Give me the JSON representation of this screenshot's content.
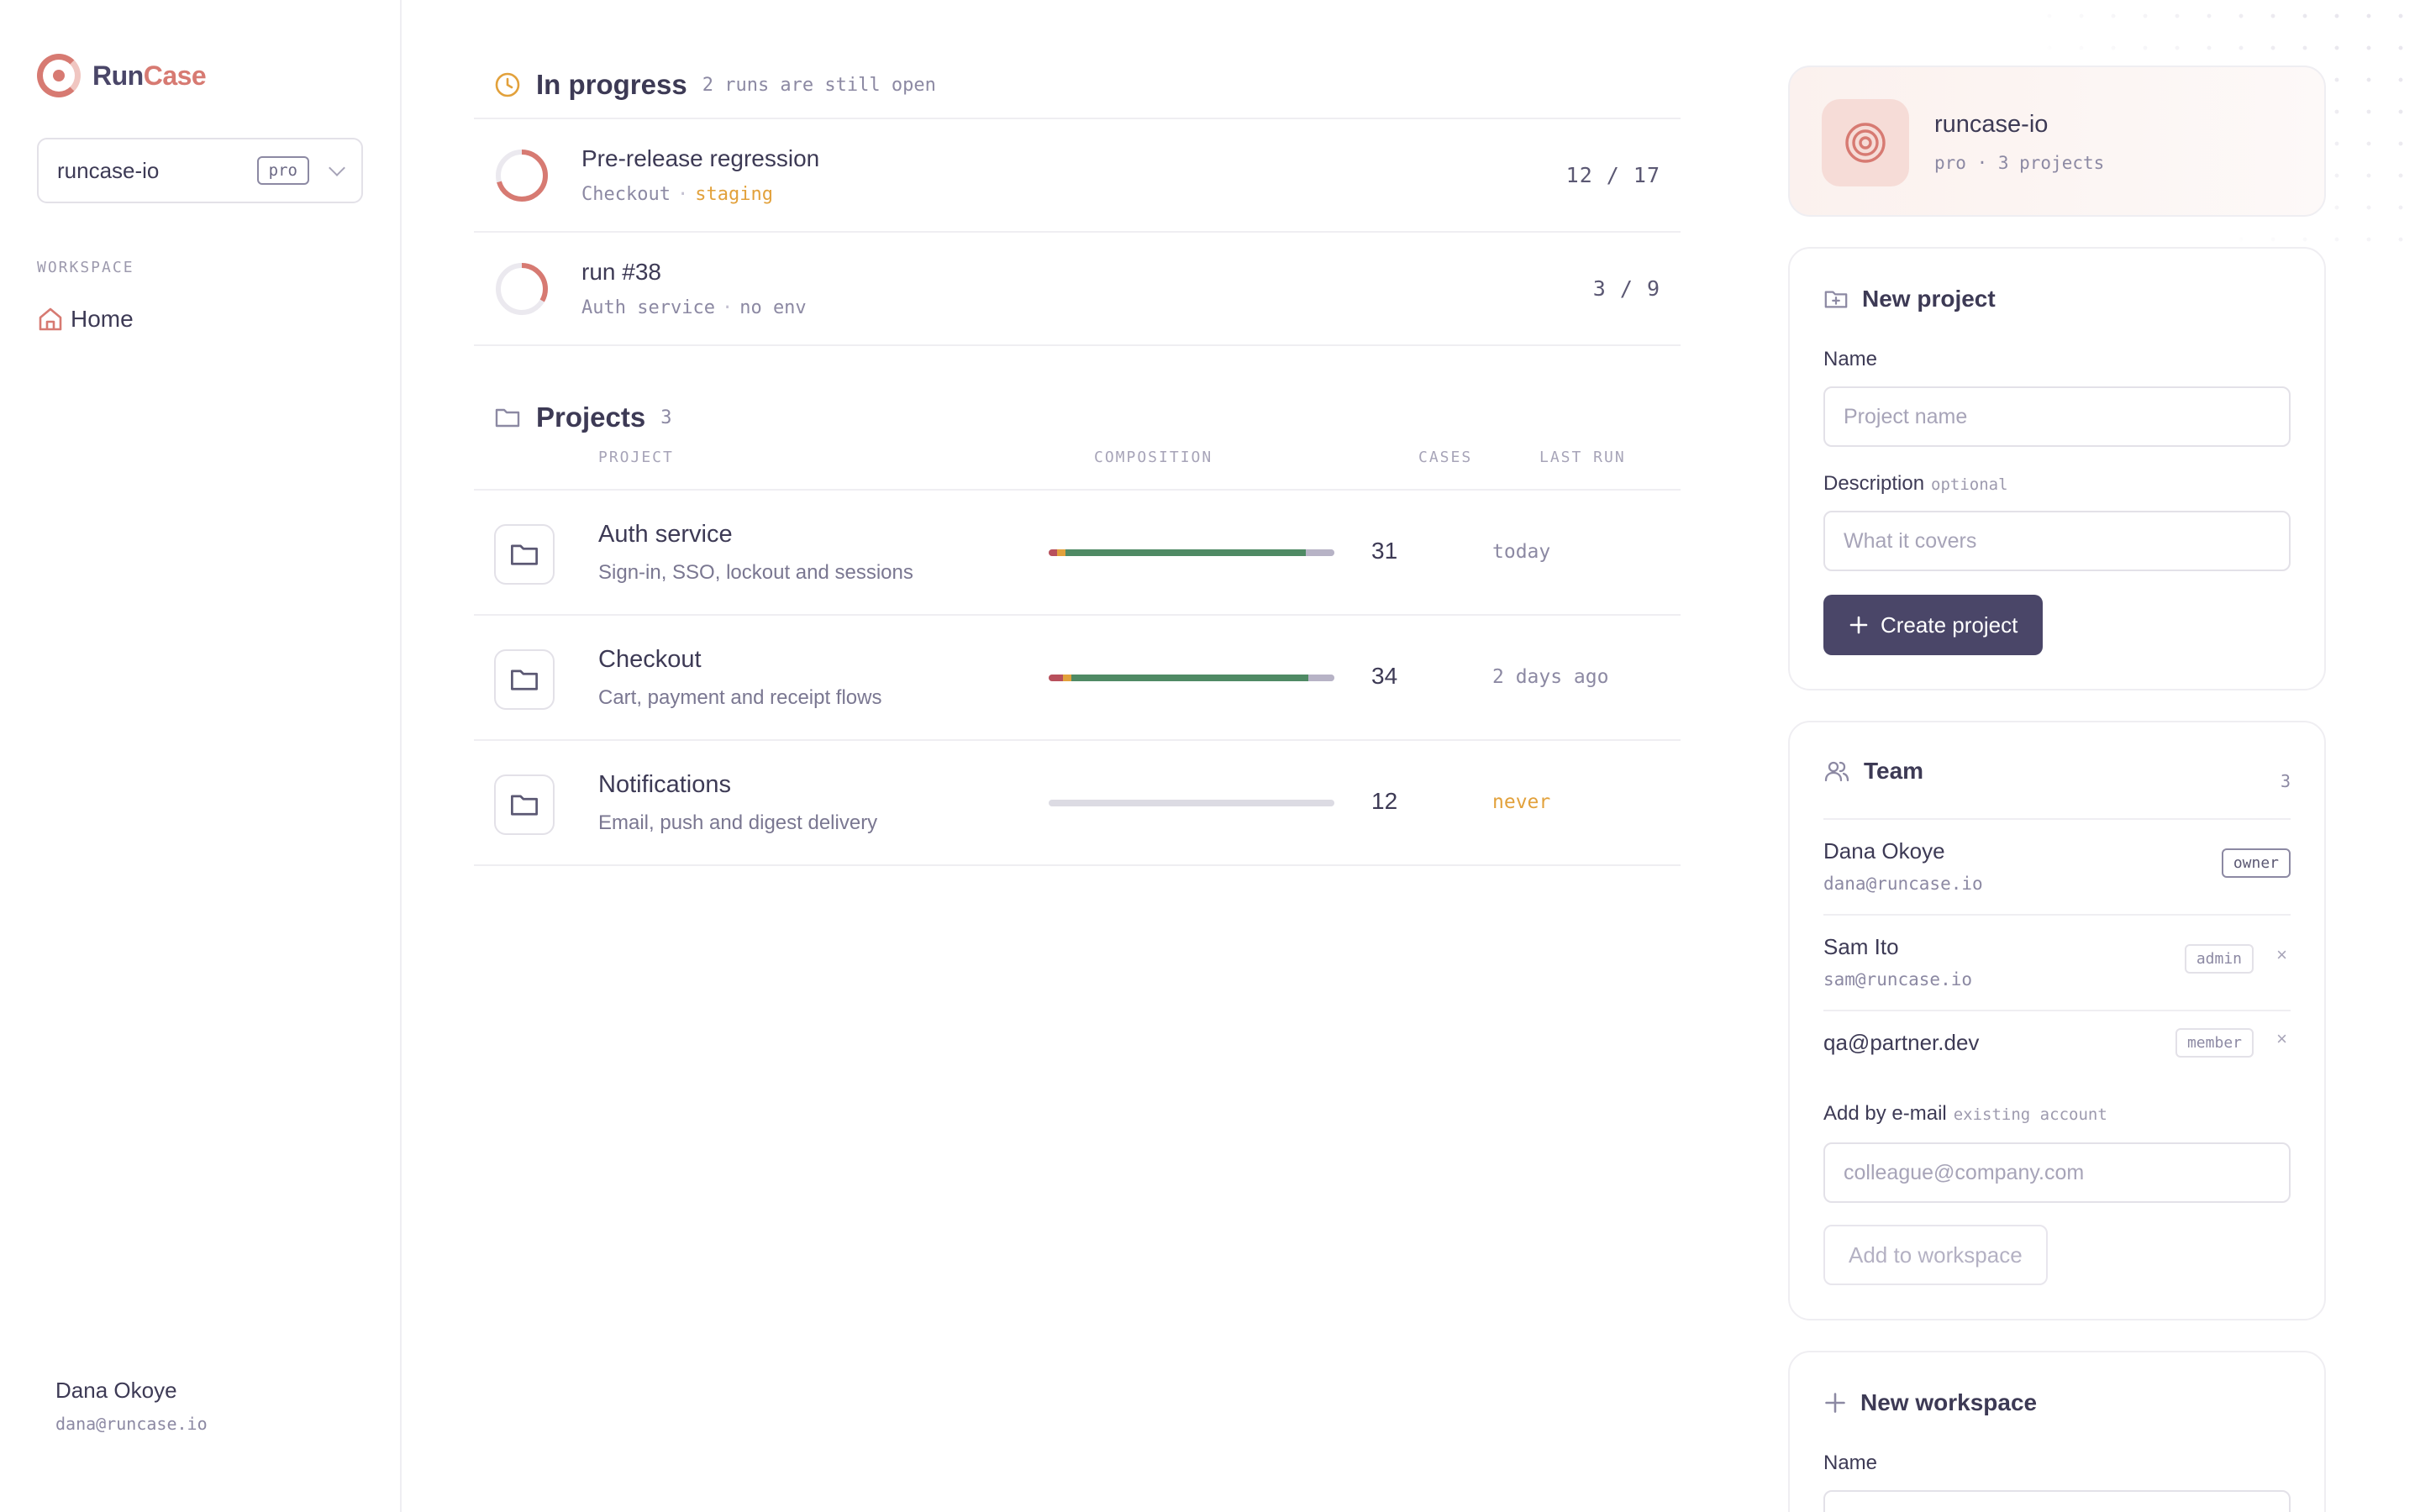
{
  "brand": {
    "part1": "Run",
    "part2": "Case"
  },
  "workspace_select": {
    "name": "runcase-io",
    "plan": "pro"
  },
  "sidebar": {
    "section": "WORKSPACE",
    "home": "Home"
  },
  "user": {
    "name": "Dana Okoye",
    "email": "dana@runcase.io"
  },
  "in_progress": {
    "title": "In progress",
    "subtitle": "2 runs are still open",
    "runs": [
      {
        "title": "Pre-release regression",
        "project": "Checkout",
        "sep": "·",
        "env": "staging",
        "count": "12 / 17",
        "progress": 0.706
      },
      {
        "title": "run #38",
        "project": "Auth service",
        "sep": "·",
        "env": "no env",
        "count": "3 / 9",
        "progress": 0.333
      }
    ]
  },
  "projects": {
    "title": "Projects",
    "count": "3",
    "columns": {
      "project": "PROJECT",
      "composition": "COMPOSITION",
      "cases": "CASES",
      "last_run": "LAST RUN"
    },
    "rows": [
      {
        "name": "Auth service",
        "desc": "Sign-in, SSO, lockout and sessions",
        "cases": "31",
        "last_run": "today",
        "composition": [
          {
            "color": "#b8505c",
            "value": 0.03
          },
          {
            "color": "#e2a13b",
            "value": 0.03
          },
          {
            "color": "#4f8a64",
            "value": 0.84
          },
          {
            "color": "#b7b3c6",
            "value": 0.1
          }
        ]
      },
      {
        "name": "Checkout",
        "desc": "Cart, payment and receipt flows",
        "cases": "34",
        "last_run": "2 days ago",
        "composition": [
          {
            "color": "#b8505c",
            "value": 0.05
          },
          {
            "color": "#e2a13b",
            "value": 0.03
          },
          {
            "color": "#4f8a64",
            "value": 0.83
          },
          {
            "color": "#b7b3c6",
            "value": 0.09
          }
        ]
      },
      {
        "name": "Notifications",
        "desc": "Email, push and digest delivery",
        "cases": "12",
        "last_run": "never",
        "composition": []
      }
    ]
  },
  "workspace_card": {
    "name": "runcase-io",
    "meta": "pro · 3 projects"
  },
  "new_project": {
    "title": "New project",
    "name_label": "Name",
    "name_placeholder": "Project name",
    "desc_label": "Description",
    "desc_optional": "optional",
    "desc_placeholder": "What it covers",
    "create_label": "Create project"
  },
  "team": {
    "title": "Team",
    "count": "3",
    "members": [
      {
        "name": "Dana Okoye",
        "email": "dana@runcase.io",
        "role": "owner"
      },
      {
        "name": "Sam Ito",
        "email": "sam@runcase.io",
        "role": "admin",
        "remove": "×"
      },
      {
        "name": "qa@partner.dev",
        "email": "",
        "role": "member",
        "remove": "×"
      }
    ],
    "add_label": "Add by e-mail",
    "add_hint": "existing account",
    "add_placeholder": "colleague@company.com",
    "add_button": "Add to workspace"
  },
  "new_workspace": {
    "title": "New workspace",
    "name_label": "Name"
  },
  "colors": {
    "accent": "#d77a72",
    "primary": "#4a4668",
    "warning": "#e2a13b",
    "success": "#4f8a64",
    "danger": "#b8505c"
  }
}
